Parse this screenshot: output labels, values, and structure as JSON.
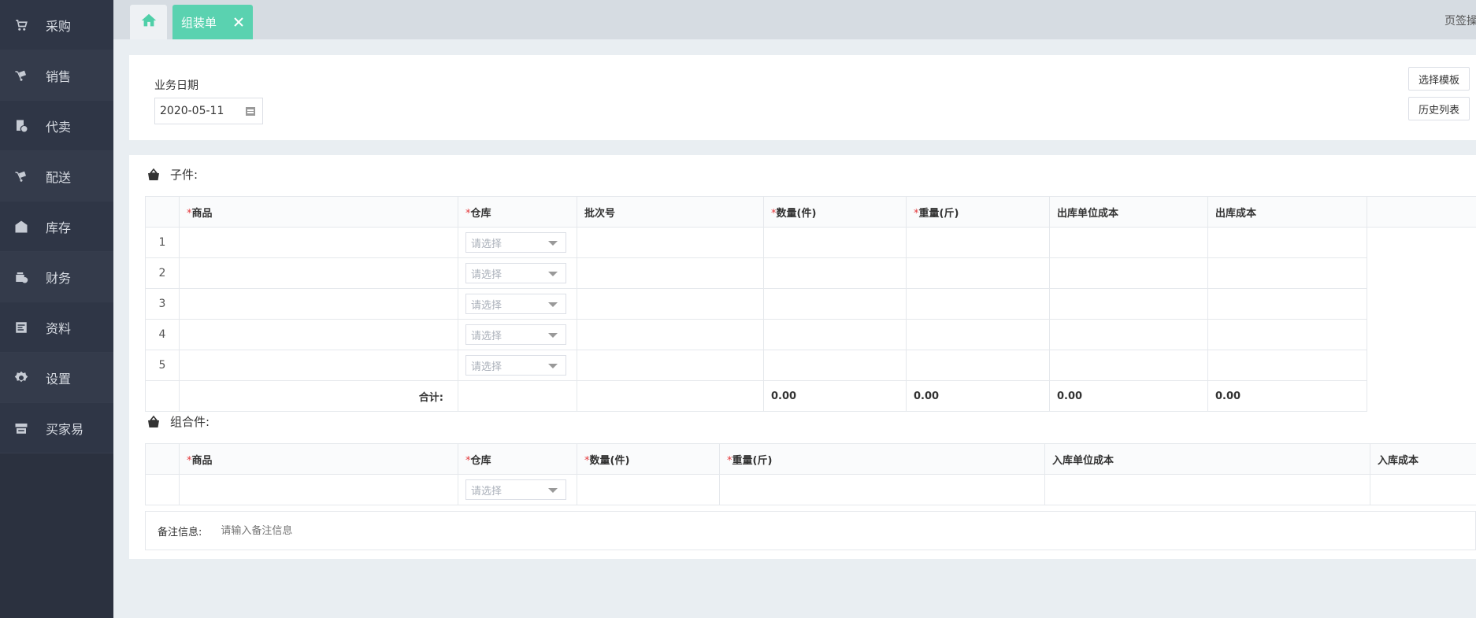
{
  "sidebar": {
    "items": [
      {
        "label": "采购",
        "icon": "cart-icon"
      },
      {
        "label": "销售",
        "icon": "trolley-icon"
      },
      {
        "label": "代卖",
        "icon": "document-icon"
      },
      {
        "label": "配送",
        "icon": "delivery-icon"
      },
      {
        "label": "库存",
        "icon": "warehouse-icon"
      },
      {
        "label": "财务",
        "icon": "finance-icon"
      },
      {
        "label": "资料",
        "icon": "data-icon"
      },
      {
        "label": "设置",
        "icon": "gear-icon"
      },
      {
        "label": "买家易",
        "icon": "store-icon"
      }
    ]
  },
  "tabbar": {
    "home_icon": "home-icon",
    "active_tab": "组装单",
    "ops_label": "页签操作"
  },
  "header": {
    "date_label": "业务日期",
    "date_value": "2020-05-11",
    "template_button": "选择模板",
    "history_button": "历史列表"
  },
  "sub_parts": {
    "title": "子件:",
    "columns": [
      "商品",
      "仓库",
      "批次号",
      "数量(件)",
      "重量(斤)",
      "出库单位成本",
      "出库成本"
    ],
    "rows": [
      {
        "index": "1",
        "warehouse_placeholder": "请选择"
      },
      {
        "index": "2",
        "warehouse_placeholder": "请选择"
      },
      {
        "index": "3",
        "warehouse_placeholder": "请选择"
      },
      {
        "index": "4",
        "warehouse_placeholder": "请选择"
      },
      {
        "index": "5",
        "warehouse_placeholder": "请选择"
      }
    ],
    "total_label": "合计:",
    "totals": {
      "quantity": "0.00",
      "weight": "0.00",
      "unit_cost": "0.00",
      "cost": "0.00"
    }
  },
  "assembly": {
    "title": "组合件:",
    "columns": [
      "商品",
      "仓库",
      "数量(件)",
      "重量(斤)",
      "入库单位成本",
      "入库成本"
    ],
    "row": {
      "warehouse_placeholder": "请选择"
    }
  },
  "remark": {
    "label": "备注信息:",
    "placeholder": "请输入备注信息"
  },
  "colors": {
    "sidebar_bg": "#2b313f",
    "accent": "#5ad2b0",
    "required": "#e4393c"
  }
}
